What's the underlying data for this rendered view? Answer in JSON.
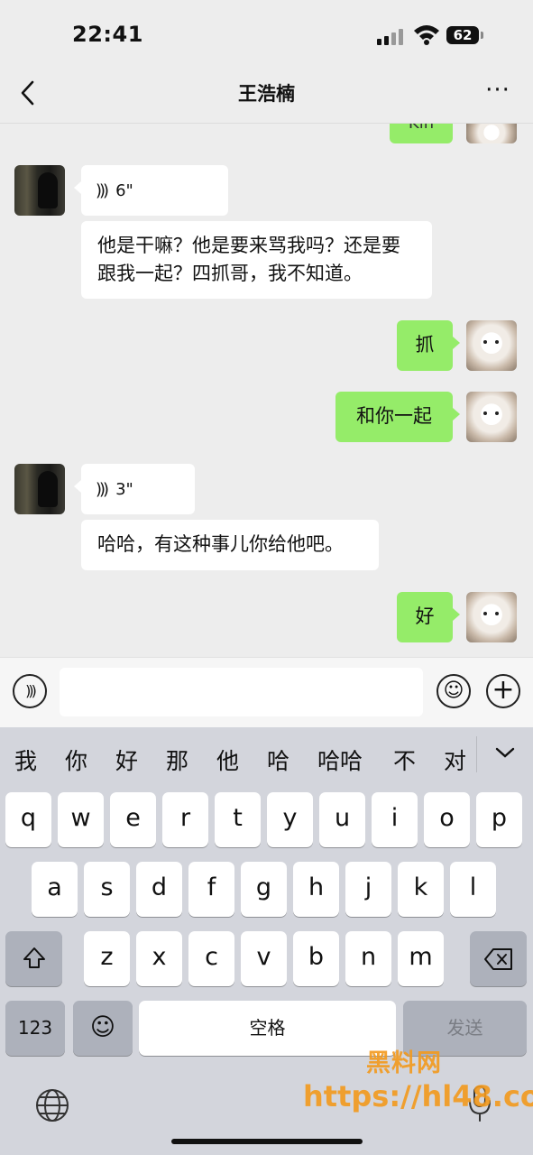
{
  "status_bar": {
    "time": "22:41",
    "battery": "62"
  },
  "nav": {
    "title": "王浩楠",
    "more": "···"
  },
  "messages": {
    "partial_top": "Kin",
    "m1_voice": "6\"",
    "m2_text": "他是干嘛？他是要来骂我吗？还是要跟我一起？四抓哥，我不知道。",
    "m3_text": "抓",
    "m4_text": "和你一起",
    "m5_voice": "3\"",
    "m6_text": "哈哈，有这种事儿你给他吧。",
    "m7_text": "好"
  },
  "keyboard": {
    "candidates": [
      "我",
      "你",
      "好",
      "那",
      "他",
      "哈",
      "哈哈",
      "不",
      "对"
    ],
    "row1": [
      "q",
      "w",
      "e",
      "r",
      "t",
      "y",
      "u",
      "i",
      "o",
      "p"
    ],
    "row2": [
      "a",
      "s",
      "d",
      "f",
      "g",
      "h",
      "j",
      "k",
      "l"
    ],
    "row3": [
      "z",
      "x",
      "c",
      "v",
      "b",
      "n",
      "m"
    ],
    "num_label": "123",
    "space_label": "空格",
    "send_label": "发送"
  },
  "watermark": {
    "line1": "黑料网",
    "line2": "https://hl48.co"
  },
  "colors": {
    "chat_bg": "#ededed",
    "sent_bubble": "#95ec69",
    "watermark": "#f39a1d"
  }
}
